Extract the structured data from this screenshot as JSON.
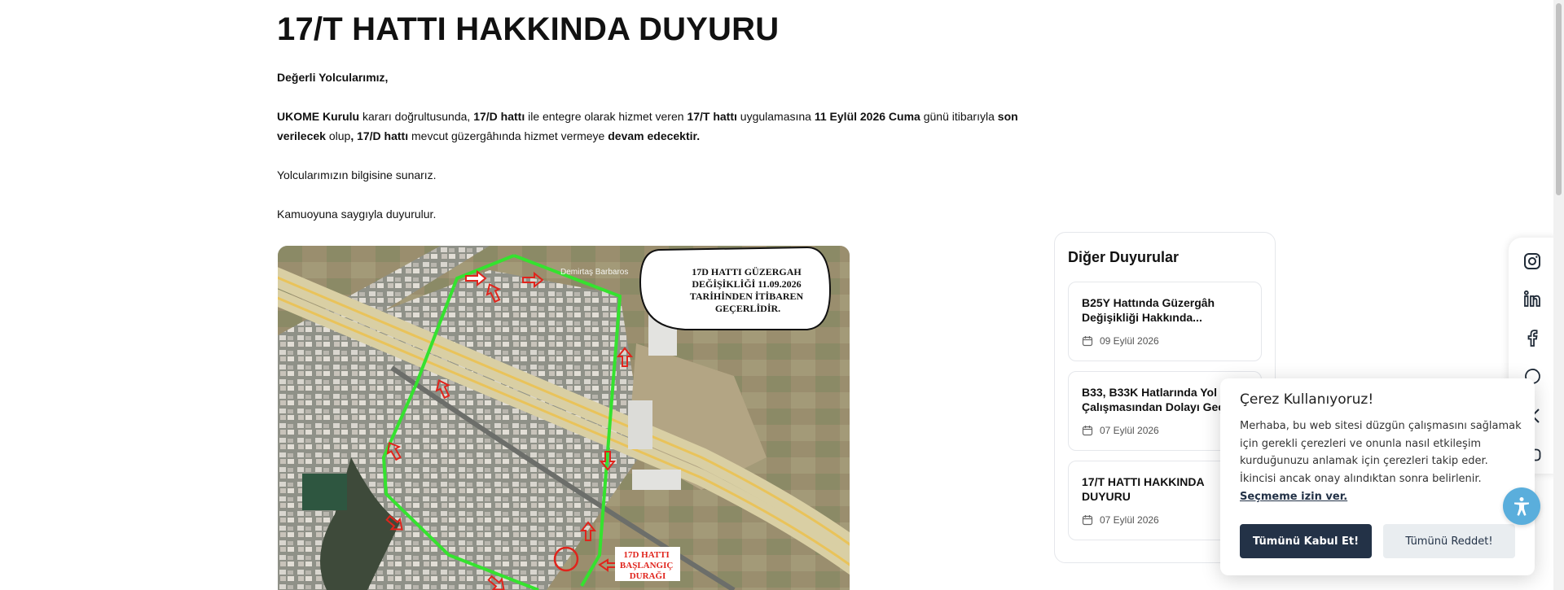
{
  "article": {
    "title": "17/T HATTI HAKKINDA DUYURU",
    "greeting": "Değerli Yolcularımız,",
    "p1": {
      "s1": "UKOME Kurulu",
      "s2": " kararı doğrultusunda, ",
      "s3": "17/D hattı",
      "s4": " ile entegre olarak hizmet veren ",
      "s5": "17/T hattı",
      "s6": " uygulamasına ",
      "s7": "11 Eylül 2026 Cuma",
      "s8": " günü itibarıyla ",
      "s9": "son verilecek",
      "s10": " olup",
      "s11": ", 17/D hattı",
      "s12": " mevcut güzergâhında hizmet vermeye ",
      "s13": "devam edecektir."
    },
    "p2": "Yolcularımızın bilgisine sunarız.",
    "p3": "Kamuoyuna saygıyla duyurulur."
  },
  "map": {
    "bubble": [
      "17D HATTI GÜZERGAH",
      "DEĞİŞİKLİĞİ 11.09.2026",
      "TARİHİNDEN İTİBAREN",
      "GEÇERLİDİR."
    ],
    "start_label": [
      "17D HATTI",
      "BAŞLANGIÇ",
      "DURAĞI"
    ],
    "place_label": "Demirtaş Barbaros"
  },
  "sidebar": {
    "title": "Diğer Duyurular",
    "items": [
      {
        "title": "B25Y Hattında Güzergâh Değişikliği Hakkında...",
        "date": "09 Eylül 2026"
      },
      {
        "title": "B33, B33K Hatlarında Yol Çalışmasından Dolayı Geç",
        "date": "07 Eylül 2026"
      },
      {
        "title": "17/T HATTI HAKKINDA DUYURU",
        "date": "07 Eylül 2026"
      }
    ]
  },
  "social": [
    "instagram-icon",
    "linkedin-icon",
    "facebook-icon",
    "whatsapp-icon",
    "x-icon",
    "youtube-icon"
  ],
  "cookie": {
    "title": "Çerez Kullanıyoruz!",
    "text": "Merhaba, bu web sitesi düzgün çalışmasını sağlamak için gerekli çerezleri ve onunla nasıl etkileşim kurduğunuzu anlamak için çerezleri takip eder. İkincisi ancak onay alındıktan sonra belirlenir.",
    "link": "Seçmeme izin ver.",
    "accept": "Tümünü Kabul Et!",
    "reject": "Tümünü Reddet!"
  },
  "colors": {
    "route": "#35e22f",
    "arrow": "#e0241c",
    "dark_button": "#233247",
    "accessibility": "#5aaedc"
  }
}
